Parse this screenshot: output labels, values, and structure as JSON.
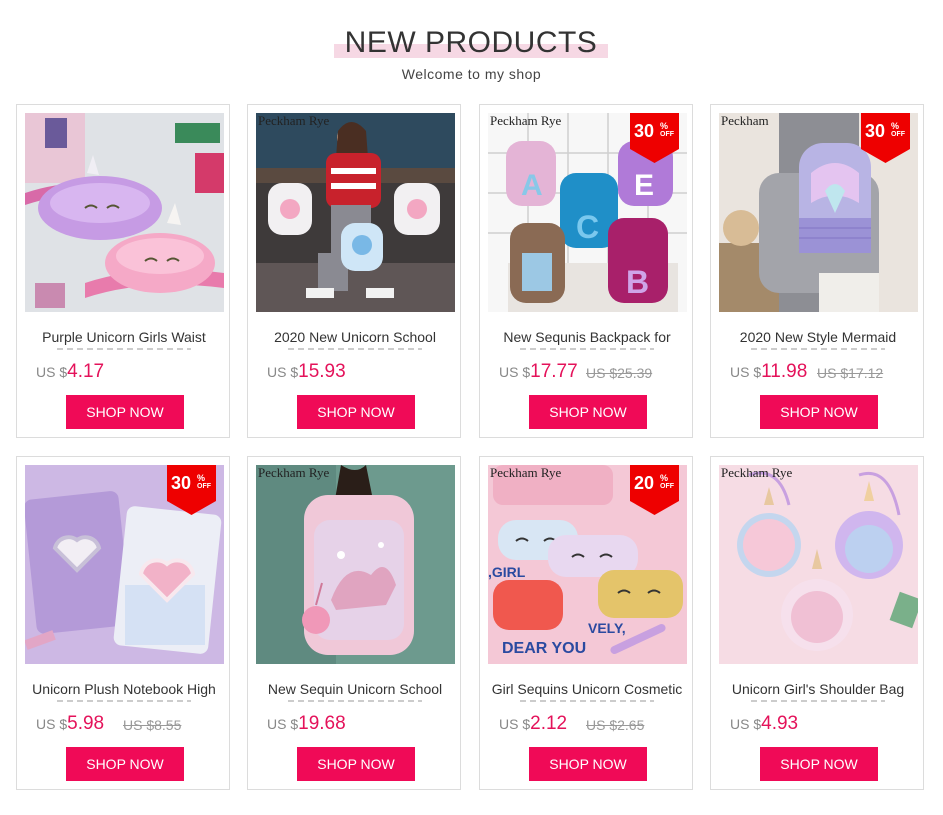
{
  "header": {
    "title": "NEW PRODUCTS",
    "subtitle": "Welcome to my shop"
  },
  "colors": {
    "accent": "#f00a57",
    "price": "#e4125a",
    "discount": "#ee0000",
    "title_bar": "#f6d8e4"
  },
  "products": [
    {
      "name": "Purple Unicorn Girls Waist",
      "brand": "",
      "currency": "US $",
      "price": "4.17",
      "old_price": "",
      "discount": "",
      "image": "plush-fanny-packs",
      "cta": "SHOP NOW"
    },
    {
      "name": "2020 New Unicorn School",
      "brand": "Peckham Rye",
      "currency": "US $",
      "price": "15.93",
      "old_price": "",
      "discount": "",
      "image": "girl-with-backpacks",
      "cta": "SHOP NOW"
    },
    {
      "name": "New Sequnis Backpack for",
      "brand": "Peckham Rye",
      "currency": "US $",
      "price": "17.77",
      "old_price": "US $25.39",
      "discount": "30",
      "image": "sequin-letter-backpacks",
      "cta": "SHOP NOW"
    },
    {
      "name": "2020 New Style Mermaid",
      "brand": "Peckham",
      "currency": "US $",
      "price": "11.98",
      "old_price": "US $17.12",
      "discount": "30",
      "image": "mermaid-backpack",
      "cta": "SHOP NOW"
    },
    {
      "name": "Unicorn Plush Notebook High",
      "brand": "",
      "currency": "US $",
      "price": "5.98",
      "old_price": "US $8.55",
      "discount": "30",
      "image": "plush-notebooks",
      "cta": "SHOP NOW"
    },
    {
      "name": "New Sequin Unicorn School",
      "brand": "Peckham Rye",
      "currency": "US $",
      "price": "19.68",
      "old_price": "",
      "discount": "",
      "image": "sequin-unicorn-backpack",
      "cta": "SHOP NOW"
    },
    {
      "name": "Girl Sequins Unicorn Cosmetic",
      "brand": "Peckham Rye",
      "currency": "US $",
      "price": "2.12",
      "old_price": "US $2.65",
      "discount": "20",
      "image": "cosmetic-bags",
      "cta": "SHOP NOW"
    },
    {
      "name": "Unicorn Girl's Shoulder Bag",
      "brand": "Peckham Rye",
      "currency": "US $",
      "price": "4.93",
      "old_price": "",
      "discount": "",
      "image": "plush-shoulder-bags",
      "cta": "SHOP NOW"
    }
  ],
  "discount_labels": {
    "symbol": "%",
    "off": "OFF"
  }
}
